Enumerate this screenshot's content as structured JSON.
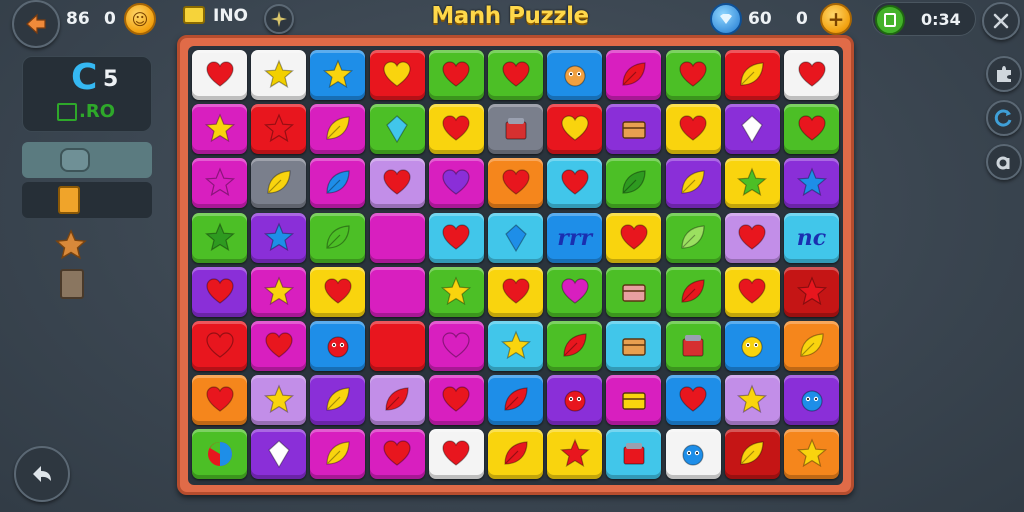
{
  "header": {
    "title": "Manh Puzzle",
    "left_value_1": "86",
    "left_value_2": "0",
    "info_label": "INO",
    "gems_value": "60",
    "coins_value": "0",
    "timer": "0:34"
  },
  "left_panel": {
    "score_big": "C",
    "score_small": "5",
    "sub_label": ".RO"
  },
  "colors": {
    "red": "#e8161e",
    "yellow": "#f9d40e",
    "green": "#4cbf26",
    "blue": "#1e8ee8",
    "purple": "#8a2fd8",
    "magenta": "#d81fbf",
    "orange": "#f5861c",
    "white": "#f4f4f4",
    "gray": "#7a7f8c",
    "cyan": "#41c6ea",
    "lavender": "#c28ee8",
    "pink": "#f46aa6",
    "dark_red": "#c51515",
    "board_frame": "#e06b48"
  },
  "grid": [
    [
      [
        "white",
        "heart",
        "#e8161e"
      ],
      [
        "white",
        "star",
        "#f2d000"
      ],
      [
        "blue",
        "star",
        "#f9d40e"
      ],
      [
        "red",
        "heart",
        "#f9d40e"
      ],
      [
        "green",
        "heart",
        "#e8161e"
      ],
      [
        "green",
        "heart",
        "#e8161e"
      ],
      [
        "blue",
        "creature",
        "#f0a040"
      ],
      [
        "magenta",
        "leaf",
        "#e8161e"
      ],
      [
        "green",
        "heart",
        "#e8161e"
      ],
      [
        "red",
        "leaf",
        "#f9d40e"
      ],
      [
        "white",
        "heart",
        "#e8161e"
      ]
    ],
    [
      [
        "magenta",
        "star",
        "#f9d40e"
      ],
      [
        "red",
        "star",
        "#e8161e"
      ],
      [
        "magenta",
        "leaf",
        "#f9d40e"
      ],
      [
        "green",
        "gem",
        "#41c6ea"
      ],
      [
        "yellow",
        "heart",
        "#e8161e"
      ],
      [
        "gray",
        "box",
        "#d63030"
      ],
      [
        "red",
        "heart",
        "#f9d40e"
      ],
      [
        "purple",
        "chest",
        "#e8a050"
      ],
      [
        "yellow",
        "heart",
        "#e8161e"
      ],
      [
        "purple",
        "gem",
        "#ffffff"
      ],
      [
        "green",
        "heart",
        "#e8161e"
      ]
    ],
    [
      [
        "magenta",
        "star",
        "#d81fbf"
      ],
      [
        "gray",
        "leaf",
        "#f9d40e"
      ],
      [
        "magenta",
        "leaf",
        "#1e8ee8"
      ],
      [
        "lavender",
        "heart",
        "#e8161e"
      ],
      [
        "magenta",
        "heart",
        "#8a2fd8"
      ],
      [
        "orange",
        "heart",
        "#e8161e"
      ],
      [
        "cyan",
        "heart",
        "#e8161e"
      ],
      [
        "green",
        "leaf",
        "#2e9a20"
      ],
      [
        "purple",
        "leaf",
        "#f9d40e"
      ],
      [
        "yellow",
        "star",
        "#4cbf26"
      ],
      [
        "purple",
        "star",
        "#1e8ee8"
      ]
    ],
    [
      [
        "green",
        "star",
        "#2e9a20"
      ],
      [
        "purple",
        "star",
        "#1e8ee8"
      ],
      [
        "green",
        "leaf",
        "#4cbf26"
      ],
      [
        "magenta",
        "none",
        ""
      ],
      [
        "cyan",
        "heart",
        "#e8161e"
      ],
      [
        "cyan",
        "gem",
        "#1e8ee8"
      ],
      [
        "blue",
        "text:rrr",
        "#1a2fb0"
      ],
      [
        "yellow",
        "heart",
        "#e8161e"
      ],
      [
        "green",
        "leaf",
        "#9be060"
      ],
      [
        "lavender",
        "heart",
        "#e8161e"
      ],
      [
        "cyan",
        "text:nc",
        "#1a2fb0"
      ]
    ],
    [
      [
        "purple",
        "heart",
        "#e8161e"
      ],
      [
        "magenta",
        "star",
        "#f9d40e"
      ],
      [
        "yellow",
        "heart",
        "#e8161e"
      ],
      [
        "magenta",
        "none",
        ""
      ],
      [
        "green",
        "star",
        "#f9d40e"
      ],
      [
        "yellow",
        "heart",
        "#e8161e"
      ],
      [
        "green",
        "heart",
        "#d81fbf"
      ],
      [
        "green",
        "chest",
        "#e8a0a0"
      ],
      [
        "green",
        "leaf",
        "#e8161e"
      ],
      [
        "yellow",
        "heart",
        "#e8161e"
      ],
      [
        "dark_red",
        "star",
        "#e8161e"
      ]
    ],
    [
      [
        "red",
        "heart",
        "#e8161e"
      ],
      [
        "magenta",
        "heart",
        "#e8161e"
      ],
      [
        "blue",
        "creature",
        "#e8161e"
      ],
      [
        "red",
        "none",
        ""
      ],
      [
        "magenta",
        "heart",
        "#d81fbf"
      ],
      [
        "cyan",
        "star",
        "#f9d40e"
      ],
      [
        "green",
        "leaf",
        "#e8161e"
      ],
      [
        "cyan",
        "chest",
        "#e8a050"
      ],
      [
        "green",
        "box",
        "#d63030"
      ],
      [
        "blue",
        "creature",
        "#f9d40e"
      ],
      [
        "orange",
        "leaf",
        "#f9d40e"
      ]
    ],
    [
      [
        "orange",
        "heart",
        "#e8161e"
      ],
      [
        "lavender",
        "star",
        "#f9d40e"
      ],
      [
        "purple",
        "leaf",
        "#f9d40e"
      ],
      [
        "lavender",
        "leaf",
        "#e8161e"
      ],
      [
        "magenta",
        "heart",
        "#e8161e"
      ],
      [
        "blue",
        "leaf",
        "#e8161e"
      ],
      [
        "purple",
        "creature",
        "#e8161e"
      ],
      [
        "magenta",
        "chest",
        "#f9d40e"
      ],
      [
        "blue",
        "heart",
        "#e8161e"
      ],
      [
        "lavender",
        "star",
        "#f9d40e"
      ],
      [
        "purple",
        "creature",
        "#1e8ee8"
      ]
    ],
    [
      [
        "green",
        "ball",
        "#e8161e"
      ],
      [
        "purple",
        "gem",
        "#ffffff"
      ],
      [
        "magenta",
        "leaf",
        "#f9d40e"
      ],
      [
        "magenta",
        "heart",
        "#e8161e"
      ],
      [
        "white",
        "heart",
        "#e8161e"
      ],
      [
        "yellow",
        "leaf",
        "#e8161e"
      ],
      [
        "yellow",
        "star",
        "#e8161e"
      ],
      [
        "cyan",
        "box",
        "#e8161e"
      ],
      [
        "white",
        "creature",
        "#1e8ee8"
      ],
      [
        "dark_red",
        "leaf",
        "#f9d40e"
      ],
      [
        "orange",
        "star",
        "#f9d40e"
      ]
    ]
  ]
}
